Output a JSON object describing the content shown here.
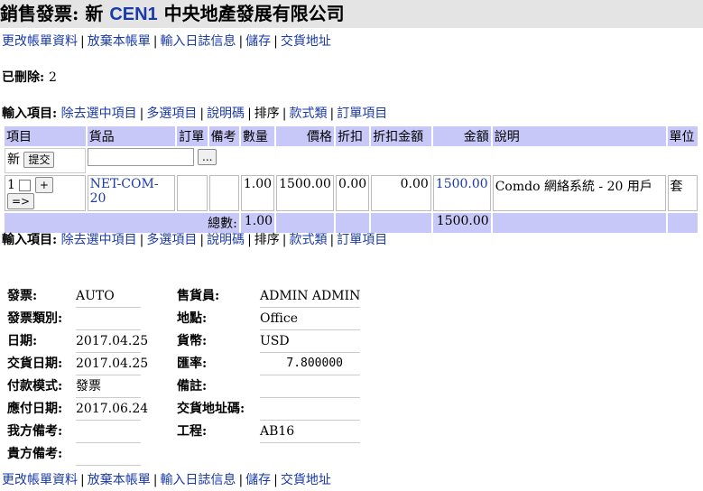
{
  "title": {
    "prefix": "銷售發票: 新",
    "code": "CEN1",
    "company": "中央地產發展有限公司"
  },
  "nav": [
    "更改帳單資料",
    "放棄本帳單",
    "輸入日誌信息",
    "儲存",
    "交貨地址"
  ],
  "deleted": {
    "label": "已刪除:",
    "value": "2"
  },
  "input_items": {
    "label": "輸入項目:",
    "links": [
      "除去選中項目",
      "多選項目",
      "說明碼",
      "排序",
      "款式類",
      "訂單項目"
    ]
  },
  "table": {
    "headers": [
      "項目",
      "貨品",
      "訂單",
      "備考",
      "數量",
      "價格",
      "折扣",
      "折扣金額",
      "金額",
      "說明",
      "單位"
    ],
    "new_row": {
      "label": "新",
      "submit": "提交",
      "browse": "..."
    },
    "items": [
      {
        "no": "1",
        "plus": "+",
        "arrow": "=>",
        "product": "NET-COM-20",
        "qty": "1.00",
        "price": "1500.00",
        "discount": "0.00",
        "discount_amount": "0.00",
        "amount": "1500.00",
        "description": "Comdo 網絡系統 - 20 用戶",
        "unit": "套"
      }
    ],
    "total": {
      "label": "總數:",
      "qty": "1.00",
      "amount": "1500.00"
    }
  },
  "form": {
    "invoice": {
      "label": "發票:",
      "value": "AUTO"
    },
    "invoice_type": {
      "label": "發票類別:",
      "value": ""
    },
    "date": {
      "label": "日期:",
      "value": "2017.04.25"
    },
    "delivery_date": {
      "label": "交貨日期:",
      "value": "2017.04.25"
    },
    "payment_mode": {
      "label": "付款模式:",
      "value": "發票"
    },
    "due_date": {
      "label": "應付日期:",
      "value": "2017.06.24"
    },
    "our_remark": {
      "label": "我方備考:",
      "value": ""
    },
    "your_remark": {
      "label": "貴方備考:",
      "value": ""
    },
    "salesman": {
      "label": "售貨員:",
      "value": "ADMIN ADMIN"
    },
    "location": {
      "label": "地點:",
      "value": "Office"
    },
    "currency": {
      "label": "貨幣:",
      "value": "USD"
    },
    "rate": {
      "label": "匯率:",
      "value": "7.800000"
    },
    "note": {
      "label": "備註:",
      "value": ""
    },
    "delivery_code": {
      "label": "交貨地址碼:",
      "value": ""
    },
    "project": {
      "label": "工程:",
      "value": "AB16"
    }
  }
}
